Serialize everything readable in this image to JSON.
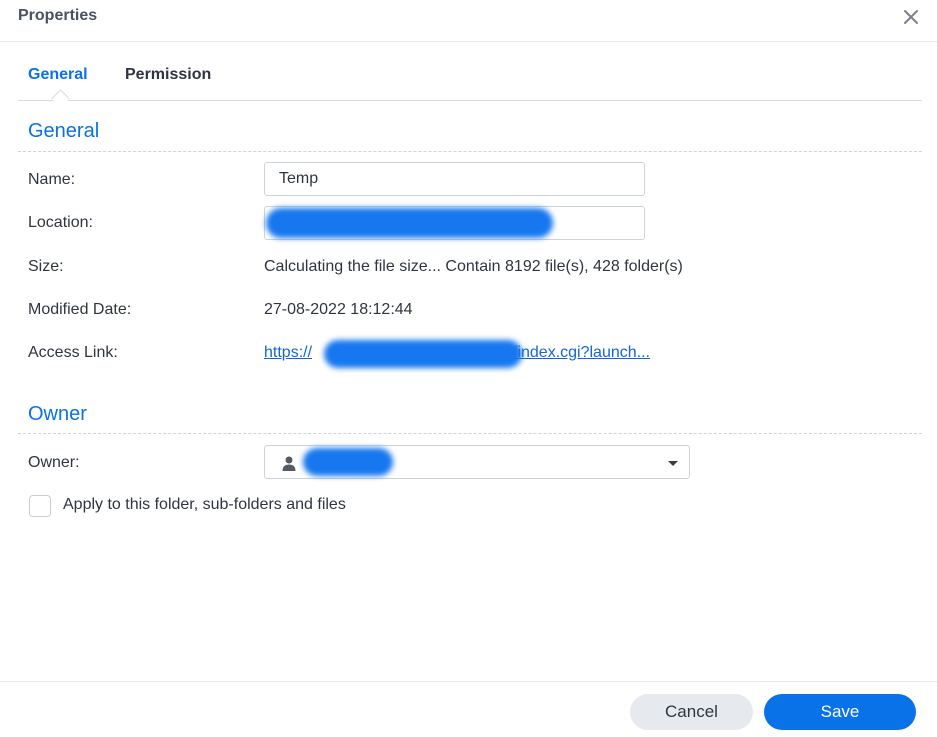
{
  "dialog": {
    "title": "Properties"
  },
  "tabs": [
    {
      "label": "General",
      "active": true
    },
    {
      "label": "Permission",
      "active": false
    }
  ],
  "general": {
    "section_title": "General",
    "name": {
      "label": "Name:",
      "value": "Temp"
    },
    "location": {
      "label": "Location:",
      "value": ""
    },
    "size": {
      "label": "Size:",
      "value": "Calculating the file size... Contain 8192 file(s), 428 folder(s)"
    },
    "modified": {
      "label": "Modified Date:",
      "value": "27-08-2022 18:12:44"
    },
    "access_link": {
      "label": "Access Link:",
      "value_start": "https://",
      "value_end": "/index.cgi?launch..."
    }
  },
  "owner": {
    "section_title": "Owner",
    "label": "Owner:",
    "value": "",
    "apply_label": "Apply to this folder, sub-folders and files",
    "apply_checked": false
  },
  "footer": {
    "cancel_label": "Cancel",
    "save_label": "Save"
  },
  "colors": {
    "accent": "#0a72e8",
    "link": "#1166d8",
    "redaction": "#1677ef"
  },
  "icons": {
    "close": "close-icon",
    "user": "user-icon",
    "dropdown": "caret-down-icon"
  }
}
